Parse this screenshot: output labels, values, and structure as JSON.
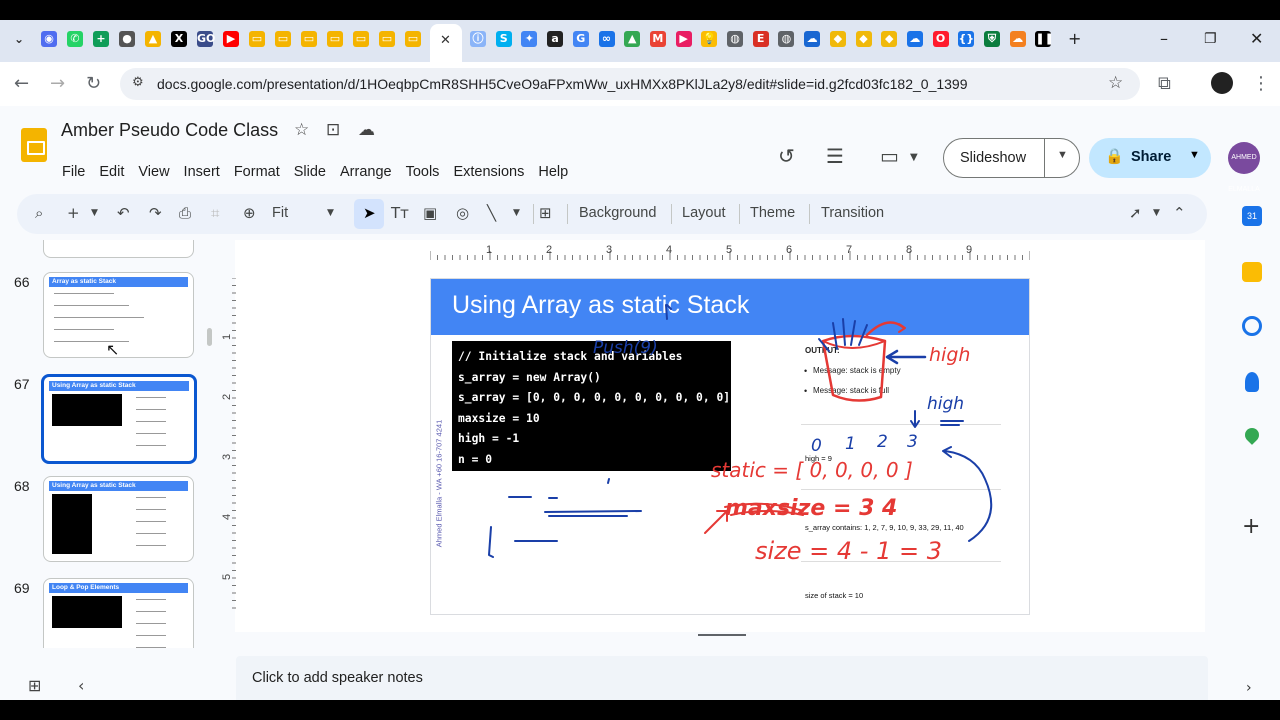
{
  "browser": {
    "url": "docs.google.com/presentation/d/1HOeqbpCmR8SHH5CveO9aFPxmWw_uxHMXx8PKlJLa2y8/edit#slide=id.g2fcd03fc182_0_1399",
    "new_tab_glyph": "+",
    "window_controls": [
      "–",
      "❐",
      "✕"
    ],
    "tab_favicons": [
      {
        "icon": "chrome-icon",
        "color": "#4f6df0",
        "glyph": "◉"
      },
      {
        "icon": "whatsapp-icon",
        "color": "#25d366",
        "glyph": "✆"
      },
      {
        "icon": "sheets-icon",
        "color": "#0f9d58",
        "glyph": "+"
      },
      {
        "icon": "avatar-icon",
        "color": "#555555",
        "glyph": "●"
      },
      {
        "icon": "drive-icon",
        "color": "#f4b400",
        "glyph": "▲"
      },
      {
        "icon": "x-icon",
        "color": "#000000",
        "glyph": "X"
      },
      {
        "icon": "gojs-icon",
        "color": "#3a4c8a",
        "glyph": "GO"
      },
      {
        "icon": "youtube-icon",
        "color": "#ff0000",
        "glyph": "▶"
      },
      {
        "icon": "slides-icon",
        "color": "#f4b400",
        "glyph": "▭"
      },
      {
        "icon": "slides-icon",
        "color": "#f4b400",
        "glyph": "▭"
      },
      {
        "icon": "slides-icon",
        "color": "#f4b400",
        "glyph": "▭"
      },
      {
        "icon": "slides-icon",
        "color": "#f4b400",
        "glyph": "▭"
      },
      {
        "icon": "slides-icon",
        "color": "#f4b400",
        "glyph": "▭"
      },
      {
        "icon": "slides-icon",
        "color": "#f4b400",
        "glyph": "▭"
      },
      {
        "icon": "slides-icon",
        "color": "#f4b400",
        "glyph": "▭"
      }
    ],
    "tab_favicons_right": [
      {
        "icon": "info-icon",
        "color": "#8ab4f8",
        "glyph": "ⓘ"
      },
      {
        "icon": "skype-icon",
        "color": "#00aff0",
        "glyph": "S"
      },
      {
        "icon": "gemini-icon",
        "color": "#4285f4",
        "glyph": "✦"
      },
      {
        "icon": "amazon-icon",
        "color": "#222222",
        "glyph": "a"
      },
      {
        "icon": "google-icon",
        "color": "#4285f4",
        "glyph": "G"
      },
      {
        "icon": "link-icon",
        "color": "#1a73e8",
        "glyph": "∞"
      },
      {
        "icon": "drive-icon",
        "color": "#34a853",
        "glyph": "▲"
      },
      {
        "icon": "gmail-icon",
        "color": "#ea4335",
        "glyph": "M"
      },
      {
        "icon": "play-icon",
        "color": "#e91e63",
        "glyph": "▶"
      },
      {
        "icon": "keep-icon",
        "color": "#fbbc04",
        "glyph": "💡"
      },
      {
        "icon": "globe-icon",
        "color": "#5f6368",
        "glyph": "◍"
      },
      {
        "icon": "e-icon",
        "color": "#d93025",
        "glyph": "E"
      },
      {
        "icon": "globe-icon",
        "color": "#5f6368",
        "glyph": "◍"
      },
      {
        "icon": "cloud-icon",
        "color": "#1967d2",
        "glyph": "☁"
      },
      {
        "icon": "binance-icon",
        "color": "#f0b90b",
        "glyph": "◆"
      },
      {
        "icon": "binance-icon",
        "color": "#f0b90b",
        "glyph": "◆"
      },
      {
        "icon": "binance-icon",
        "color": "#f0b90b",
        "glyph": "◆"
      },
      {
        "icon": "cloud-icon",
        "color": "#1a73e8",
        "glyph": "☁"
      },
      {
        "icon": "opera-icon",
        "color": "#ff1b2d",
        "glyph": "O"
      },
      {
        "icon": "code-icon",
        "color": "#1a73e8",
        "glyph": "{}"
      },
      {
        "icon": "shield-icon",
        "color": "#0a7d3e",
        "glyph": "⛨"
      },
      {
        "icon": "cloudflare-icon",
        "color": "#f38020",
        "glyph": "☁"
      },
      {
        "icon": "pause-icon",
        "color": "#000000",
        "glyph": "❚❚"
      }
    ]
  },
  "docs": {
    "title": "Amber Pseudo Code Class",
    "menu": [
      "File",
      "Edit",
      "View",
      "Insert",
      "Format",
      "Slide",
      "Arrange",
      "Tools",
      "Extensions",
      "Help"
    ],
    "slideshow_label": "Slideshow",
    "share_label": "Share",
    "avatar_text": "AHMED ELMALLA"
  },
  "toolbar": {
    "zoom": "Fit",
    "buttons": [
      "Background",
      "Layout",
      "Theme",
      "Transition"
    ]
  },
  "filmstrip": [
    {
      "number": "66",
      "title": "Array as static Stack",
      "selected": false
    },
    {
      "number": "67",
      "title": "Using Array as static Stack",
      "selected": true
    },
    {
      "number": "68",
      "title": "Using Array as static Stack",
      "selected": false
    },
    {
      "number": "69",
      "title": "Loop & Pop Elements",
      "selected": false
    }
  ],
  "rulers": {
    "horizontal": [
      "1",
      "2",
      "3",
      "4",
      "5",
      "6",
      "7",
      "8",
      "9"
    ],
    "vertical": [
      "1",
      "2",
      "3",
      "4",
      "5"
    ]
  },
  "slide": {
    "title": "Using Array as static Stack",
    "code": [
      "// Initialize stack and variables",
      "s_array = new Array()",
      "s_array = [0, 0, 0, 0, 0, 0, 0, 0, 0, 0]",
      "maxsize = 10",
      "high = -1",
      "n = 0"
    ],
    "credit": "Ahmed Elmalla - WA +60 16-707 4241",
    "output": {
      "label": "OUTPUT:",
      "messages": [
        "Message: stack is empty",
        "Message: stack is full"
      ],
      "high_text": "high = 9",
      "array_text": "s_array contains: 1, 2, 7, 9, 10, 9, 33, 29, 11, 40",
      "size_text": "size of stack = 10"
    },
    "annotations": {
      "push": "Push(9)",
      "high1": "high",
      "high2": "high",
      "indices": [
        "0",
        "1",
        "2",
        "3"
      ],
      "static_arr": "static = [ 0, 0, 0, 0 ]",
      "maxsize": "maxsize = 3 4",
      "size": "size = 4 - 1 = 3",
      "ink_red": "#e53935",
      "ink_blue": "#1a3fa8"
    }
  },
  "notes_placeholder": "Click to add speaker notes"
}
